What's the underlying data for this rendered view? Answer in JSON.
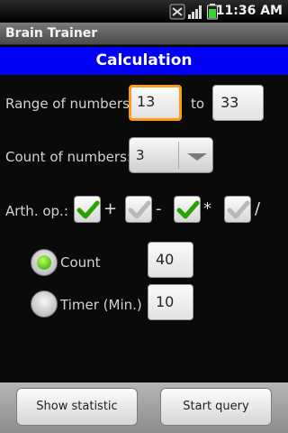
{
  "status_bar": {
    "time": "11:36 AM",
    "icons": [
      "notification-icon",
      "signal-icon",
      "battery-icon"
    ]
  },
  "app": {
    "title": "Brain Trainer"
  },
  "header": {
    "title": "Calculation",
    "color": "#0000f4"
  },
  "range": {
    "label": "Range of numbers:",
    "from": "13",
    "to_label": "to",
    "to": "33"
  },
  "count": {
    "label": "Count of numbers:",
    "selected": "3"
  },
  "operations": {
    "label": "Arth. op.:",
    "items": [
      {
        "symbol": "+",
        "checked": true
      },
      {
        "symbol": "-",
        "checked": false
      },
      {
        "symbol": "*",
        "checked": true
      },
      {
        "symbol": "/",
        "checked": false
      }
    ]
  },
  "mode": {
    "count": {
      "label": "Count",
      "value": "40",
      "selected": true
    },
    "timer": {
      "label": "Timer (Min.)",
      "value": "10",
      "selected": false
    }
  },
  "buttons": {
    "statistic": "Show statistic",
    "start": "Start query"
  },
  "colors": {
    "focus_border": "#ff9b1a",
    "check_active": "#2aa300",
    "check_inactive": "#b8b8b8"
  }
}
